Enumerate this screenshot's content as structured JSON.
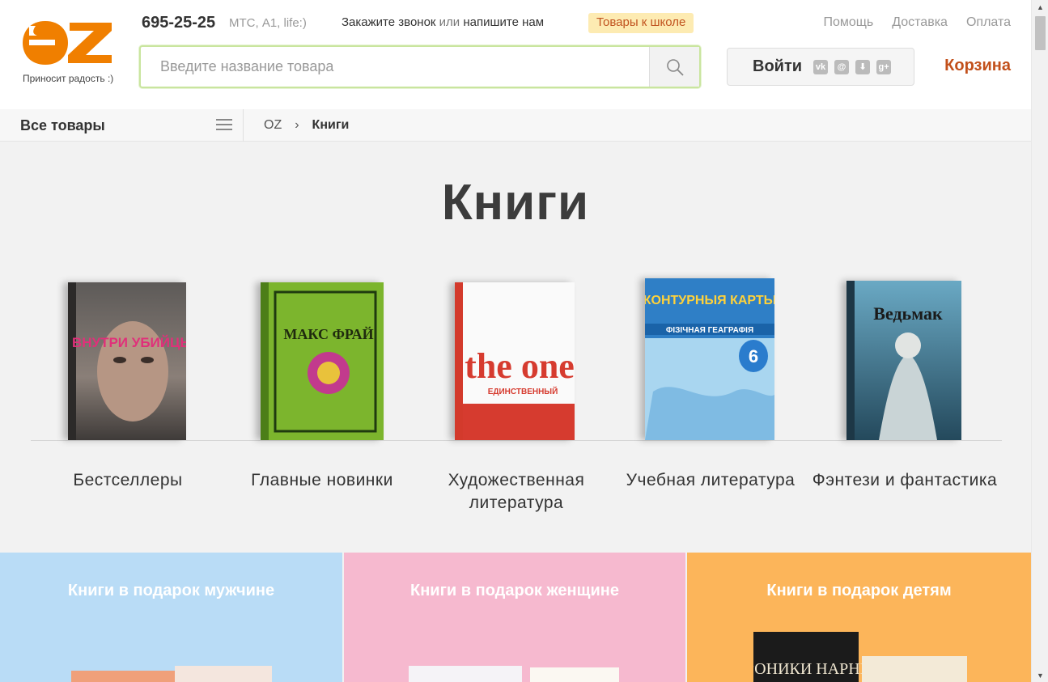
{
  "header": {
    "logo_tagline": "Приносит радость :)",
    "phone": "695-25-25",
    "operators": "МТС, А1, life:)",
    "callback": {
      "call": "Закажите звонок",
      "or": "или",
      "write": "напишите нам"
    },
    "school_badge": "Товары к школе",
    "links": [
      "Помощь",
      "Доставка",
      "Оплата"
    ],
    "search": {
      "placeholder": "Введите название товара",
      "value": ""
    },
    "login_label": "Войти",
    "social_icons": [
      "vk-icon",
      "mail-icon",
      "download-icon",
      "google-plus-icon"
    ],
    "cart_label": "Корзина"
  },
  "nav": {
    "all_goods": "Все товары",
    "breadcrumb": {
      "root": "OZ",
      "separator": "›",
      "current": "Книги"
    }
  },
  "main": {
    "title": "Книги",
    "categories": [
      {
        "label": "Бестселлеры",
        "cover_title": "ВНУТРИ УБИЙЦЫ"
      },
      {
        "label": "Главные новинки",
        "cover_title": "МАКС ФРАЙ"
      },
      {
        "label": "Художественная литература",
        "cover_title": "the one",
        "cover_subtitle": "ЕДИНСТВЕННЫЙ"
      },
      {
        "label": "Учебная литература",
        "cover_title": "КОНТУРНЫЯ КАРТЫ",
        "cover_subtitle": "ФІЗІЧНАЯ ГЕАГРАФІЯ",
        "cover_badge": "6"
      },
      {
        "label": "Фэнтези и фантастика",
        "cover_title": "Ведьмак"
      }
    ]
  },
  "gifts": [
    {
      "title": "Книги в подарок мужчине",
      "color": "#b9dcf6"
    },
    {
      "title": "Книги в подарок женщине",
      "color": "#f6b9cf"
    },
    {
      "title": "Книги в подарок детям",
      "color": "#fcb55a",
      "cover_title": "ХРОНИКИ НАРНИИ"
    }
  ],
  "colors": {
    "brand_orange": "#f07f00",
    "cart": "#c2501b",
    "search_border": "#c9e59f"
  }
}
